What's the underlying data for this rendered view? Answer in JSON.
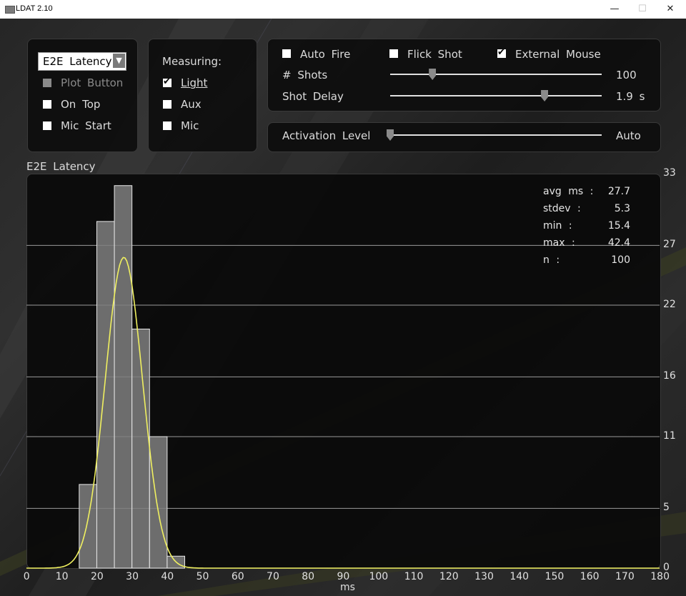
{
  "window": {
    "title": "LDAT 2.10",
    "minimize_icon": "minimize-icon",
    "maximize_icon": "maximize-icon",
    "close_icon": "close-icon"
  },
  "plot_select": {
    "value": "E2E Latency"
  },
  "options": {
    "plot_button": "Plot Button",
    "plot_button_checked": false,
    "plot_button_disabled": true,
    "on_top": "On Top",
    "on_top_checked": false,
    "mic_start": "Mic Start",
    "mic_start_checked": false
  },
  "measuring": {
    "title": "Measuring:",
    "light": "Light",
    "light_checked": true,
    "aux": "Aux",
    "aux_checked": false,
    "mic": "Mic",
    "mic_checked": false
  },
  "shots": {
    "auto_fire": "Auto Fire",
    "auto_fire_checked": false,
    "flick_shot": "Flick Shot",
    "flick_shot_checked": false,
    "external_mouse": "External Mouse",
    "external_mouse_checked": true,
    "num_shots_label": "# Shots",
    "num_shots_value": "100",
    "num_shots_fraction": 0.2,
    "shot_delay_label": "Shot Delay",
    "shot_delay_value": "1.9 s",
    "shot_delay_fraction": 0.73
  },
  "activation": {
    "label": "Activation Level",
    "value": "Auto",
    "fraction": 0.0
  },
  "chart_data": {
    "type": "bar",
    "title": "E2E Latency",
    "xlabel": "ms",
    "ylabel": "",
    "xlim": [
      0,
      180
    ],
    "ylim": [
      0,
      33
    ],
    "x_ticks": [
      0,
      10,
      20,
      30,
      40,
      50,
      60,
      70,
      80,
      90,
      100,
      110,
      120,
      130,
      140,
      150,
      160,
      170,
      180
    ],
    "y_ticks": [
      0,
      5,
      11,
      16,
      22,
      27,
      33
    ],
    "bin_width": 5,
    "bins": [
      {
        "x0": 15,
        "value": 7
      },
      {
        "x0": 20,
        "value": 29
      },
      {
        "x0": 25,
        "value": 32
      },
      {
        "x0": 30,
        "value": 20
      },
      {
        "x0": 35,
        "value": 11
      },
      {
        "x0": 40,
        "value": 1
      }
    ],
    "fit_curve": {
      "type": "gaussian",
      "mean": 27.7,
      "stdev": 5.3,
      "peak": 26,
      "color": "#f0f060"
    },
    "grid": true,
    "stats": [
      {
        "label": "avg ms :",
        "value": "27.7"
      },
      {
        "label": "stdev :",
        "value": "5.3"
      },
      {
        "label": "min :",
        "value": "15.4"
      },
      {
        "label": "max :",
        "value": "42.4"
      },
      {
        "label": "n :",
        "value": "100"
      }
    ]
  }
}
